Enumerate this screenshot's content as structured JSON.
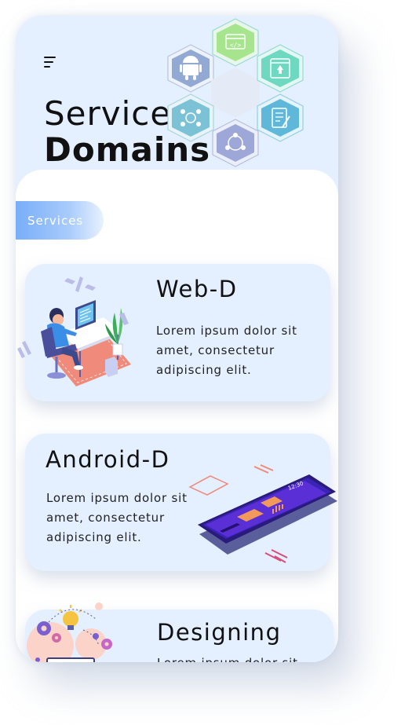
{
  "header": {
    "title_line1": "Service",
    "title_line2": "Domains"
  },
  "icons": {
    "menu": "hamburger-menu-icon",
    "hexes": [
      "code-window-icon",
      "android-icon",
      "placeholder-hex",
      "web-rocket-icon",
      "network-cube-icon",
      "document-edit-icon",
      "user-network-icon"
    ]
  },
  "tab": {
    "label": "Services"
  },
  "cards": [
    {
      "title": "Web-D",
      "text": "Lorem ipsum dolor sit amet, consectetur adipiscing elit."
    },
    {
      "title": "Android-D",
      "text": "Lorem ipsum dolor sit amet, consectetur adipiscing elit."
    },
    {
      "title": "Designing",
      "text": "Lorem ipsum dolor sit"
    }
  ],
  "colors": {
    "background": "#e4efff",
    "accent_blue": "#78adf9",
    "card_bg": "#e4efff"
  }
}
